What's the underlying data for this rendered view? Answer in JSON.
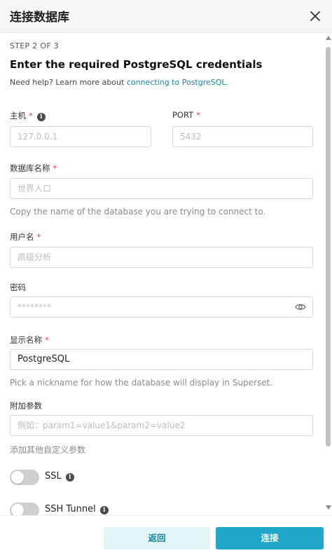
{
  "modal": {
    "title": "连接数据库"
  },
  "form": {
    "step": "STEP 2 OF 3",
    "heading": "Enter the required PostgreSQL credentials",
    "help_prefix": "Need help? Learn more about ",
    "help_link": "connecting to PostgreSQL.",
    "required_mark": "*",
    "info_glyph": "i",
    "host": {
      "label": "主机",
      "placeholder": "127.0.0.1",
      "value": ""
    },
    "port": {
      "label": "PORT",
      "placeholder": "5432",
      "value": ""
    },
    "database": {
      "label": "数据库名称",
      "placeholder": "世界人口",
      "hint": "Copy the name of the database you are trying to connect to."
    },
    "username": {
      "label": "用户名",
      "placeholder": "高级分析"
    },
    "password": {
      "label": "密码",
      "placeholder": "********"
    },
    "display_name": {
      "label": "显示名称",
      "value": "PostgreSQL",
      "hint": "Pick a nickname for how the database will display in Superset."
    },
    "extra_params": {
      "label": "附加参数",
      "placeholder": "例如：param1=value1&param2=value2",
      "hint": "添加其他自定义参数"
    },
    "ssl": {
      "label": "SSL",
      "enabled": false
    },
    "ssh_tunnel": {
      "label": "SSH Tunnel",
      "enabled": false
    }
  },
  "footer": {
    "back_label": "返回",
    "connect_label": "连接"
  },
  "colors": {
    "accent": "#20a7c9",
    "link": "#1a85a0",
    "required": "#e04355",
    "back_bg": "#e3f4f6"
  }
}
